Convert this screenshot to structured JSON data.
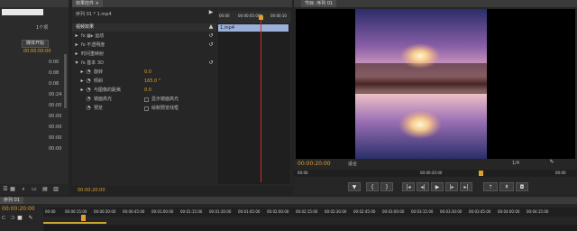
{
  "left_panel": {
    "title": "",
    "items": [
      "1个项",
      "媒体开始",
      "00:00:00:00"
    ],
    "list": [
      "0:00",
      "0:08",
      "0:08",
      "00:24",
      "00:00",
      "00:00",
      "00:00",
      "00:00",
      "00:00"
    ]
  },
  "effect_controls": {
    "tab": "效果控件",
    "tab_x": "×",
    "clip_name": "序列 01 * 1.mp4",
    "header_label": "视频效果",
    "ruler_times": [
      "00:00",
      "00:00:05:00",
      "00:00:10"
    ],
    "clip_label": "1.mp4",
    "rows": [
      {
        "label": "fx ▦▸ 运动"
      },
      {
        "label": "fx 不透明度"
      },
      {
        "label": "时间重映射"
      },
      {
        "label": "fx 基本 3D"
      },
      {
        "label": "旋转",
        "value": "0.0"
      },
      {
        "label": "倾斜",
        "value": "165.0 °"
      },
      {
        "label": "与图像的距离",
        "value": "0.0"
      },
      {
        "label": "镜面高光",
        "value": "显示镜面高光"
      },
      {
        "label": "预览",
        "value": "绘制预览线框"
      }
    ],
    "bottom_time": "00:00:20:00"
  },
  "program_monitor": {
    "tab": "节目: 序列 01",
    "timecode": "00:00:20:00",
    "fit": "适合",
    "quality": "1/4",
    "ruler_times": [
      "00:00",
      "00:00:20:00",
      "00:00"
    ]
  },
  "timeline": {
    "tab": "序列 01",
    "timecode": "00:00:20:00",
    "ruler_times": [
      "00:00",
      "00:00:15:00",
      "00:00:30:00",
      "00:00:45:00",
      "00:01:00:00",
      "00:01:15:00",
      "00:01:30:00",
      "00:01:45:00",
      "00:02:00:00",
      "00:02:15:00",
      "00:02:30:00",
      "00:02:45:00",
      "00:03:00:00",
      "00:03:15:00",
      "00:03:30:00",
      "00:03:45:00",
      "00:04:00:00",
      "00:04:15:00"
    ]
  },
  "colors": {
    "accent": "#e0a030",
    "playhead": "#c23030",
    "clip": "#9ab0d8"
  }
}
